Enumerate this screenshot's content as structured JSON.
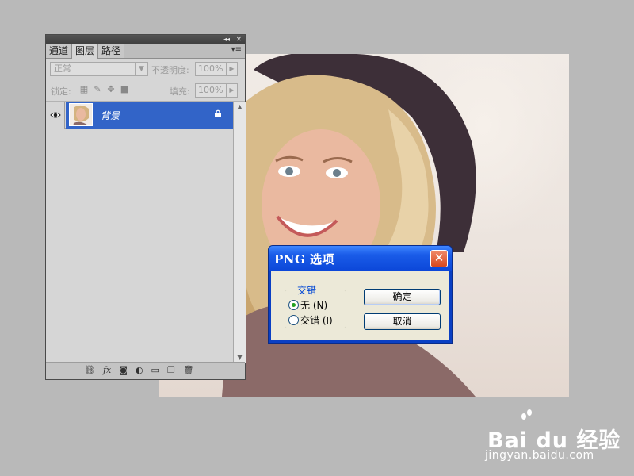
{
  "layers_panel": {
    "tabs": [
      {
        "label": "通道",
        "active": false
      },
      {
        "label": "图层",
        "active": true
      },
      {
        "label": "路径",
        "active": false
      }
    ],
    "titlebar_collapse": "◂◂",
    "titlebar_close": "✕",
    "menu_icon": "▾≡",
    "blend_mode": "正常",
    "opacity_label": "不透明度:",
    "opacity_value": "100%",
    "lock_label": "锁定:",
    "fill_label": "填充:",
    "fill_value": "100%",
    "layer": {
      "name": "背景",
      "visible": true,
      "locked": true
    },
    "scroll_up": "▲",
    "scroll_down": "▼",
    "footer_icons": [
      "link-icon",
      "fx-icon",
      "mask-icon",
      "adjustment-icon",
      "folder-icon",
      "new-layer-icon",
      "trash-icon"
    ],
    "footer_fx": "fx"
  },
  "dialog": {
    "title": "PNG 选项",
    "close": "✕",
    "group_label": "交错",
    "options": [
      {
        "label": "无 (N)",
        "selected": true
      },
      {
        "label": "交错 (I)",
        "selected": false
      }
    ],
    "ok_label": "确定",
    "cancel_label": "取消"
  },
  "watermark": {
    "logo_text": "Bai du 经验",
    "url": "jingyan.baidu.com"
  },
  "colors": {
    "selection_blue": "#3264c8",
    "dialog_title_blue": "#0b46d8",
    "close_red": "#d9481e",
    "workspace_gray": "#b9b9b9"
  }
}
